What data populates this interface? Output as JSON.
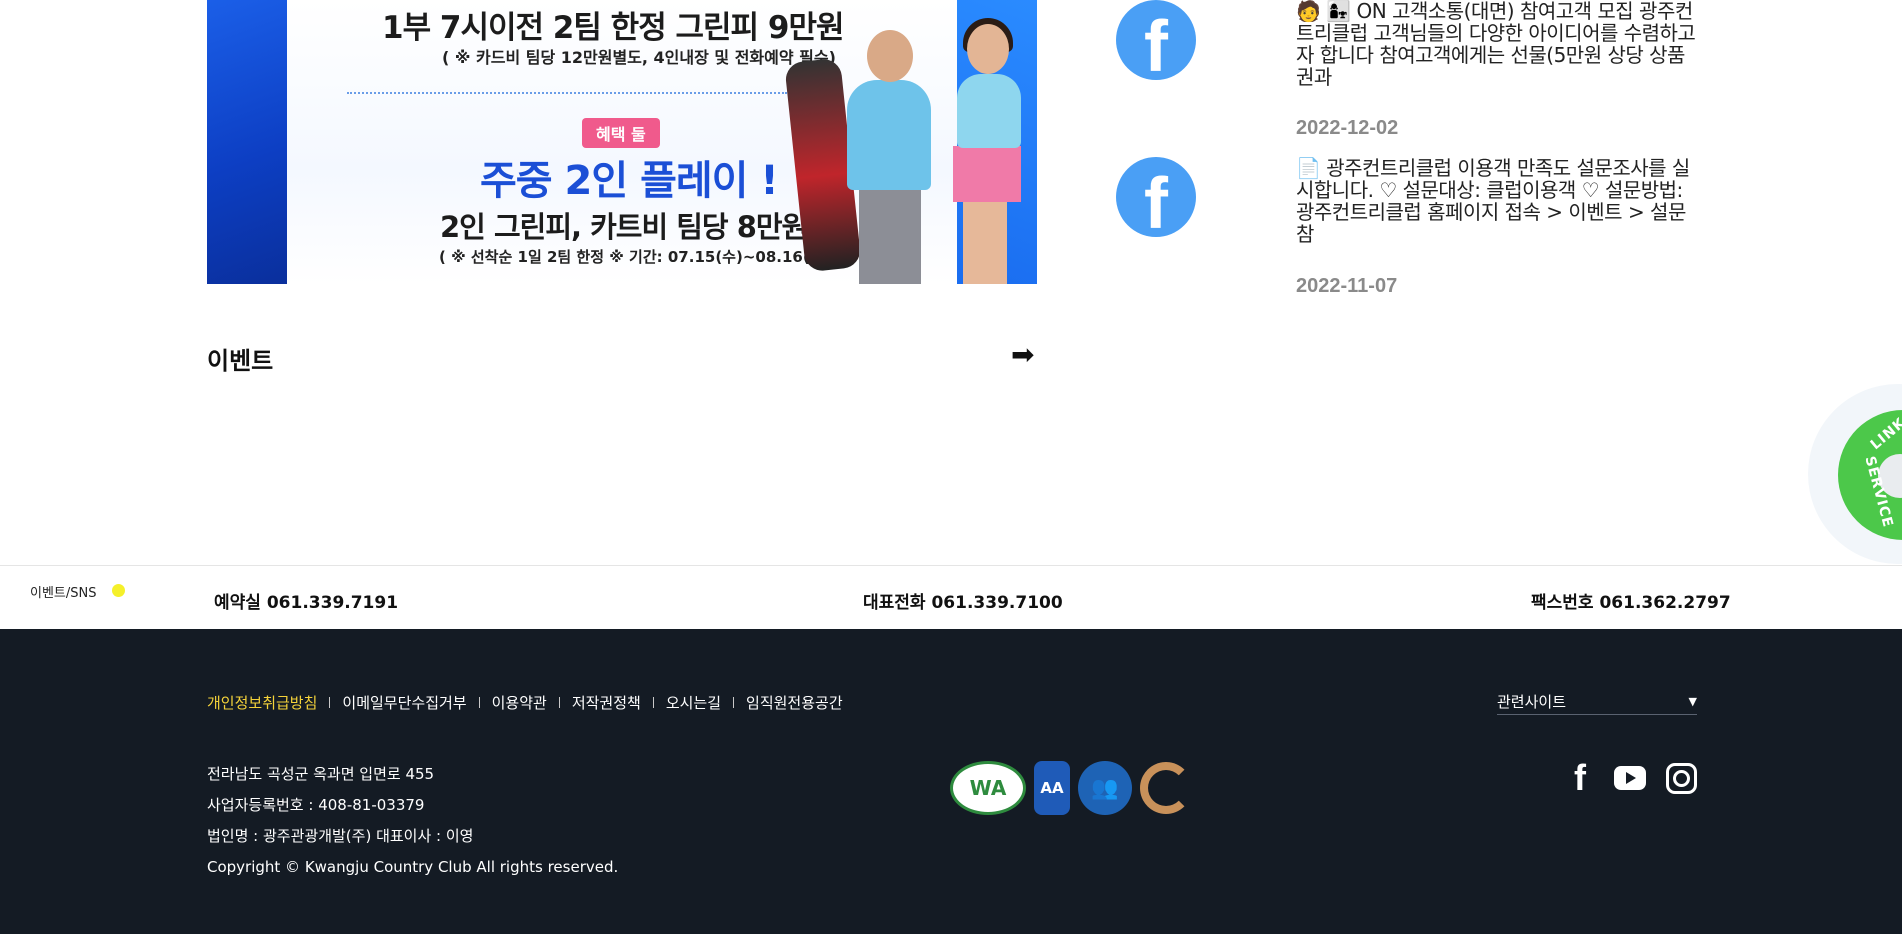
{
  "banner": {
    "line1": "1부 7시이전 2팀 한정 그린피 9만원",
    "line2": "( ※ 카드비 팀당 12만원별도, 4인내장 및 전화예약 필수)",
    "badge": "혜택 둘",
    "line3": "주중 2인 플레이 !",
    "line4": "2인 그린피, 카트비 팀당 8만원",
    "line5": "( ※ 선착순 1일 2팀 한정  ※ 기간: 07.15(수)~08.16(금) )"
  },
  "sns_posts": [
    {
      "icon": "facebook-icon",
      "text": "🧑 👩‍👧 ON 고객소통(대면) 참여고객 모집 광주컨트리클럽 고객님들의 다양한 아이디어를 수렴하고자 합니다 참여고객에게는 선물(5만원 상당 상품권과",
      "date": "2022-12-02"
    },
    {
      "icon": "facebook-icon",
      "text": "📄 광주컨트리클럽 이용객 만족도 설문조사를 실시합니다. ♡ 설문대상: 클럽이용객 ♡ 설문방법: 광주컨트리클럽 홈페이지 접속 > 이벤트 > 설문참",
      "date": "2022-11-07"
    }
  ],
  "event": {
    "title": "이벤트",
    "arrow": "➡"
  },
  "service_badge": {
    "text1": "LINK",
    "text2": "SERVICE",
    "color": "#4cc84a"
  },
  "contact_bar": {
    "sns_label": "이벤트/SNS",
    "reservation": "예약실 061.339.7191",
    "main_phone": "대표전화 061.339.7100",
    "fax": "팩스번호 061.362.2797"
  },
  "footer": {
    "links": [
      "개인정보취급방침",
      "이메일무단수집거부",
      "이용약관",
      "저작권정책",
      "오시는길",
      "임직원전용공간"
    ],
    "related_sites": "관련사이트",
    "address": "전라남도 곡성군 옥과면 입면로 455",
    "business_number": "사업자등록번호 : 408-81-03379",
    "corporation": "법인명 : 광주관광개발(주) 대표이사 : 이영",
    "copyright": "Copyright © Kwangju Country Club All rights reserved.",
    "certs": [
      "WA",
      "AA",
      "privacy",
      "C"
    ],
    "social": [
      "facebook-icon",
      "youtube-icon",
      "instagram-icon"
    ]
  },
  "colors": {
    "footer_bg": "#141b24",
    "highlight": "#f4d23a",
    "facebook": "#4a9ff5",
    "sns_dot": "#f5f02a"
  }
}
